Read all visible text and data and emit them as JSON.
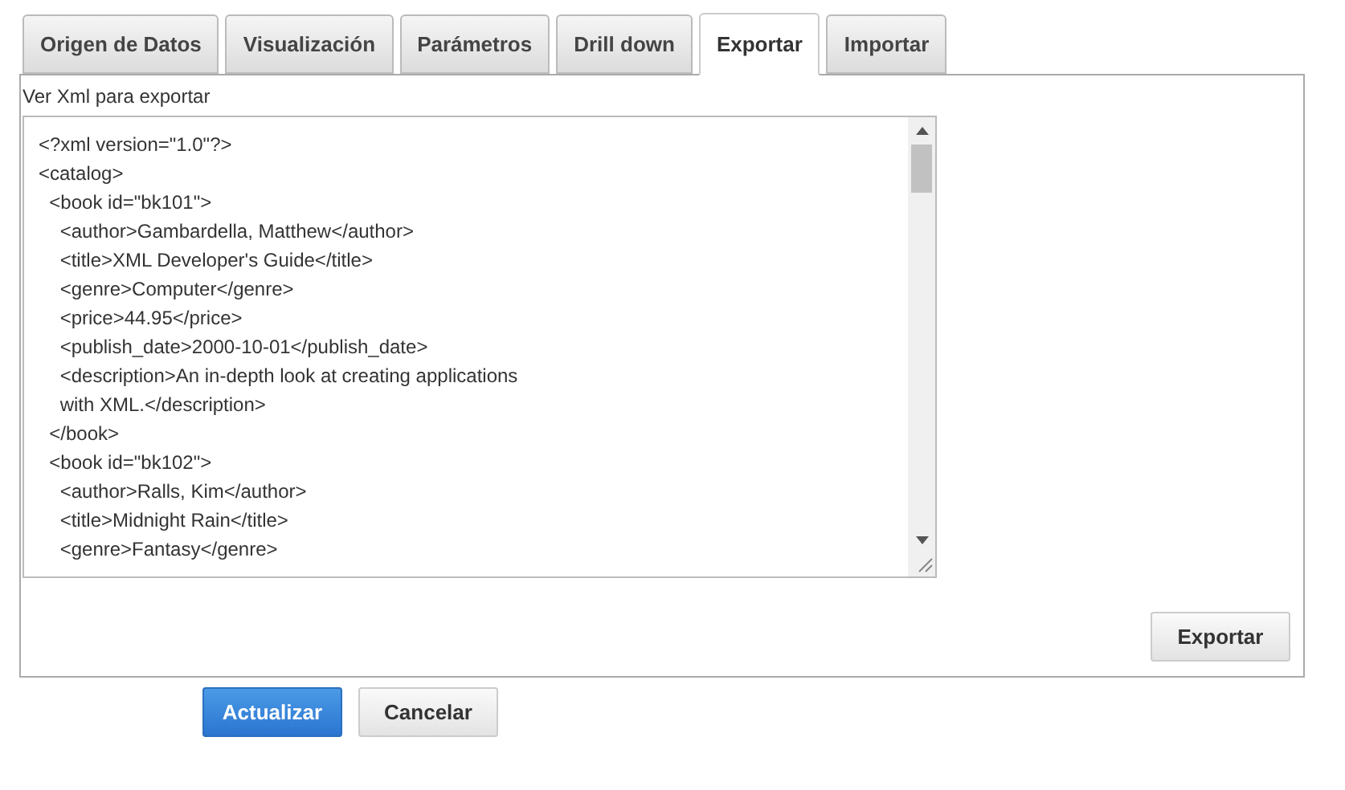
{
  "tabs": [
    {
      "label": "Origen de Datos",
      "selected": false
    },
    {
      "label": "Visualización",
      "selected": false
    },
    {
      "label": "Parámetros",
      "selected": false
    },
    {
      "label": "Drill down",
      "selected": false
    },
    {
      "label": "Exportar",
      "selected": true
    },
    {
      "label": "Importar",
      "selected": false
    }
  ],
  "panel": {
    "label": "Ver Xml para exportar",
    "xml_lines": [
      "<?xml version=\"1.0\"?>",
      "<catalog>",
      "  <book id=\"bk101\">",
      "    <author>Gambardella, Matthew</author>",
      "    <title>XML Developer's Guide</title>",
      "    <genre>Computer</genre>",
      "    <price>44.95</price>",
      "    <publish_date>2000-10-01</publish_date>",
      "    <description>An in-depth look at creating applications",
      "    with XML.</description>",
      "  </book>",
      "  <book id=\"bk102\">",
      "    <author>Ralls, Kim</author>",
      "    <title>Midnight Rain</title>",
      "    <genre>Fantasy</genre>"
    ],
    "export_button": "Exportar"
  },
  "buttons": [
    {
      "label": "Actualizar",
      "kind": "primary"
    },
    {
      "label": "Cancelar",
      "kind": "secondary"
    }
  ]
}
